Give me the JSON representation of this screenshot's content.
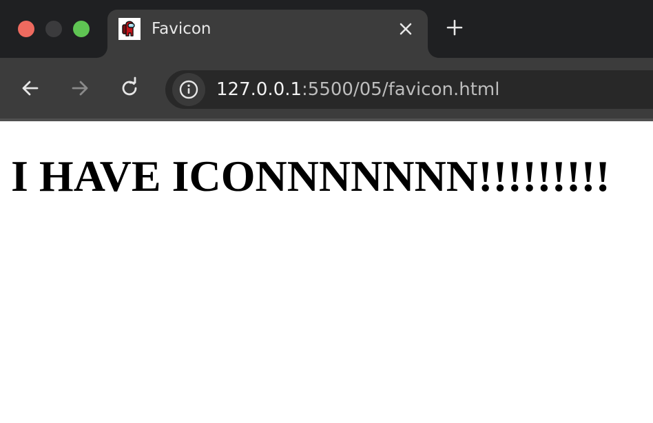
{
  "window": {
    "traffic_lights": [
      "close",
      "minimize",
      "maximize"
    ]
  },
  "tab": {
    "title": "Favicon",
    "favicon": "among-us-crewmate-icon"
  },
  "address_bar": {
    "url_host": "127.0.0.1",
    "url_rest": ":5500/05/favicon.html"
  },
  "page": {
    "heading": "I HAVE ICONNNNNNN!!!!!!!!!"
  },
  "colors": {
    "tab_strip": "#1f2022",
    "active_tab": "#3c3c3c",
    "omnibox": "#282828",
    "close_light": "#ee6a5f",
    "maximize_light": "#5fc453"
  }
}
